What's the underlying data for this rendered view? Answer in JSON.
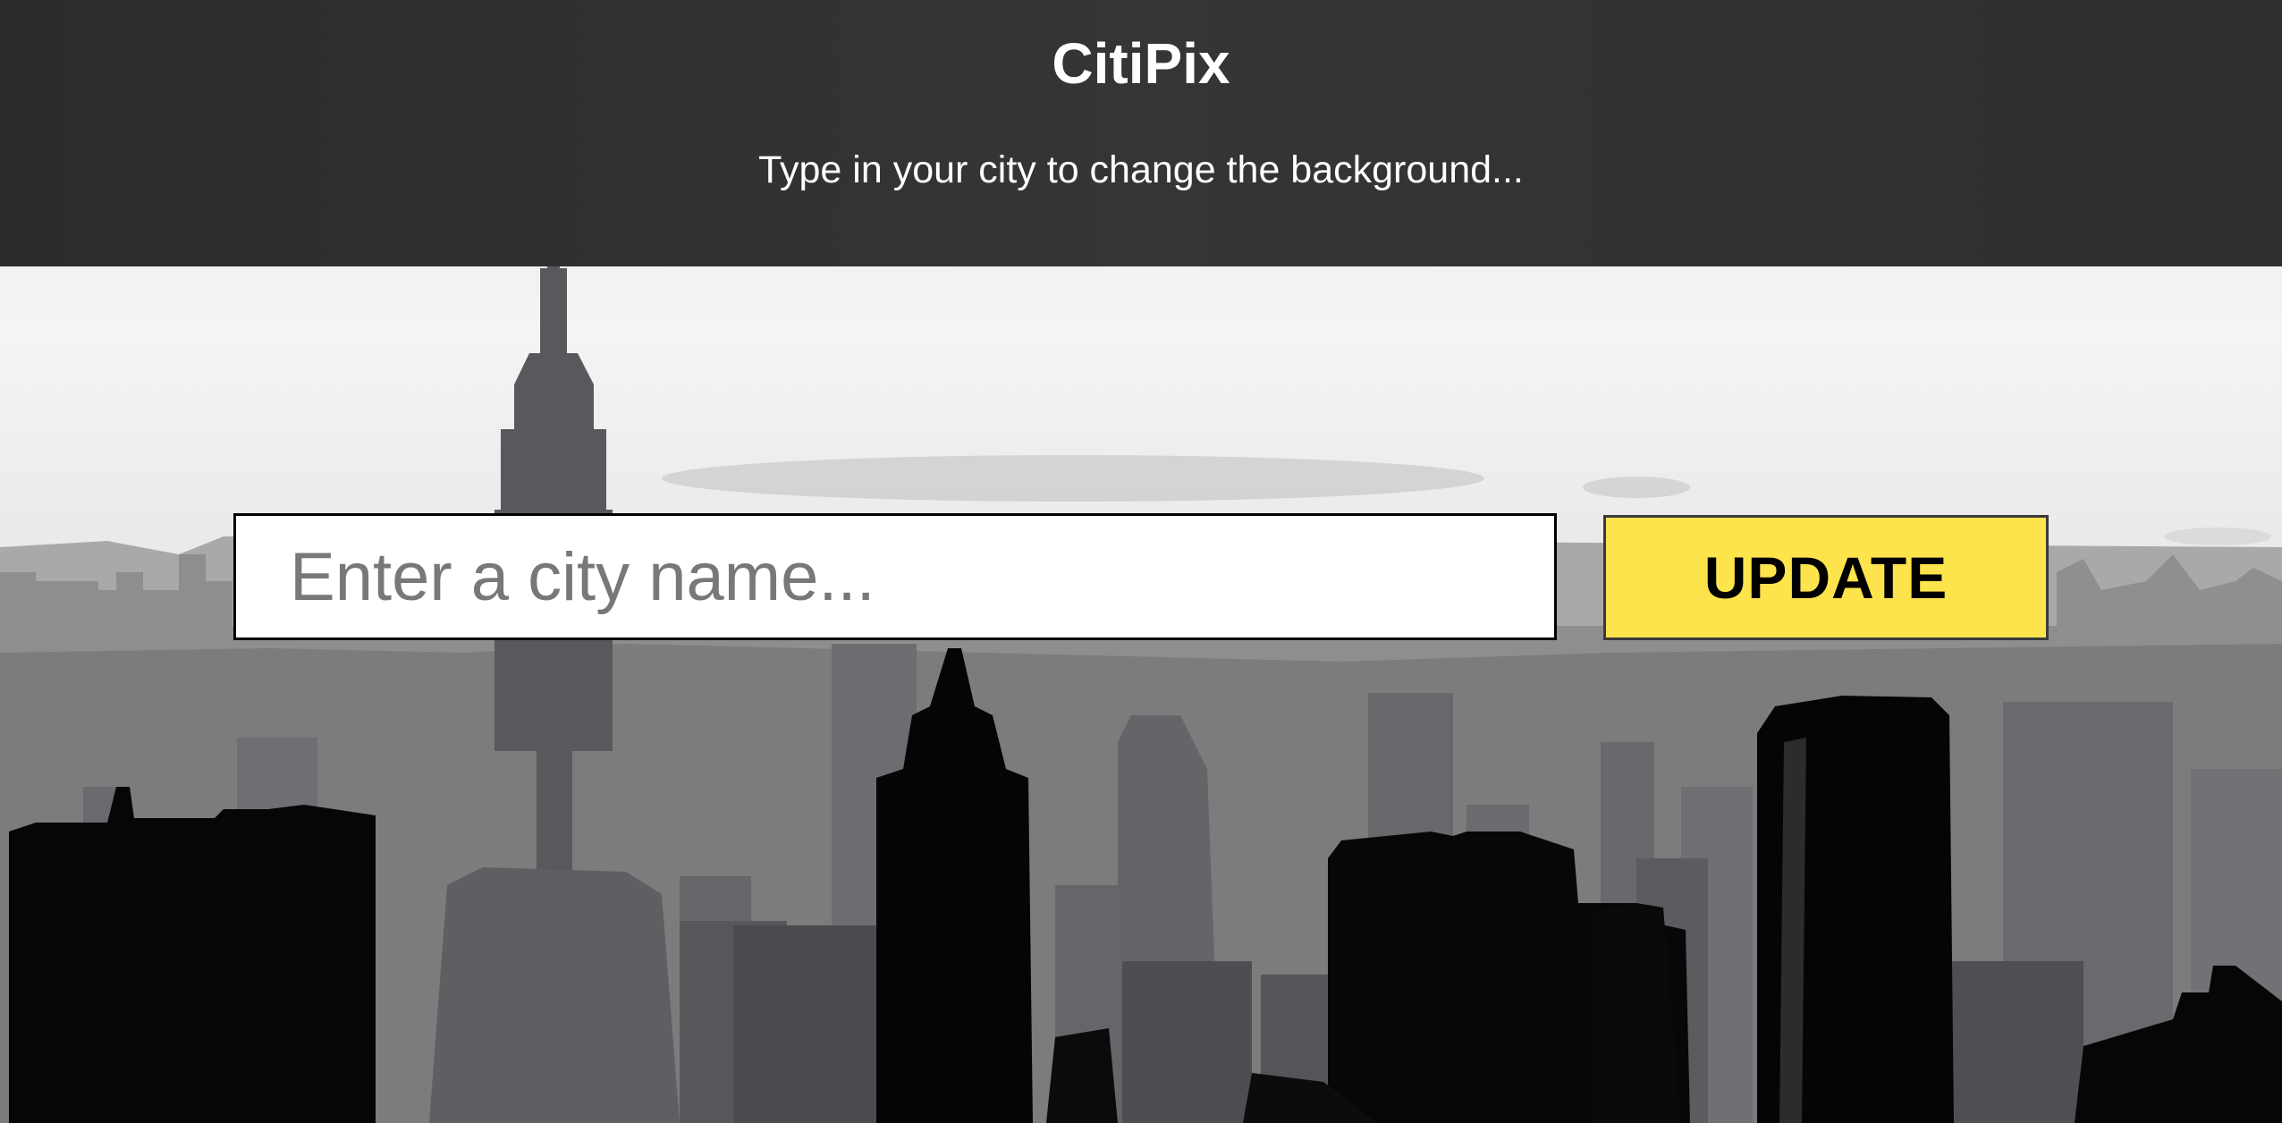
{
  "header": {
    "title": "CitiPix",
    "subtitle": "Type in your city to change the background..."
  },
  "search": {
    "placeholder": "Enter a city name...",
    "value": "",
    "button_label": "UPDATE"
  },
  "colors": {
    "header_bg": "#2f2f2f",
    "button_bg": "#fde44c",
    "text_light": "#ffffff"
  }
}
